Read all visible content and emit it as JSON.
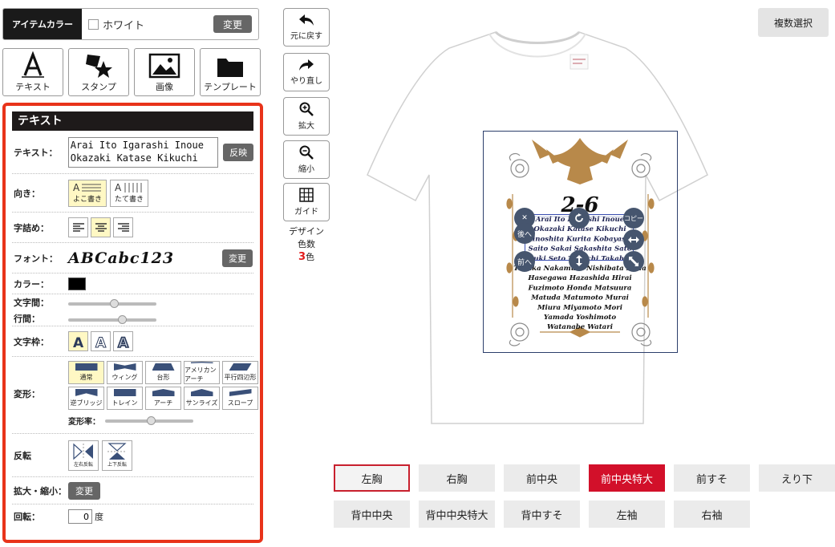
{
  "item_color": {
    "label": "アイテムカラー",
    "value": "ホワイト",
    "change": "変更"
  },
  "tools": [
    "テキスト",
    "スタンプ",
    "画像",
    "テンプレート"
  ],
  "panel": {
    "title": "テキスト",
    "text_label": "テキスト：",
    "text_value": "Arai Ito Igarashi Inoue\nOkazaki Katase Kikuchi",
    "apply": "反映",
    "orientation_label": "向き：",
    "orientation_options": [
      "よこ書き",
      "たて書き"
    ],
    "align_label": "字詰め：",
    "font_label": "フォント：",
    "font_preview": "ABCabc123",
    "font_change": "変更",
    "color_label": "カラー：",
    "text_color": "#000000",
    "spacing_label": "文字間：",
    "letter_spacing": 0.5,
    "line_label": "行間：",
    "line_spacing": 0.6,
    "outline_label": "文字枠：",
    "warp_label": "変形：",
    "warp_options": [
      "通常",
      "ウィング",
      "台形",
      "アメリカンアーチ",
      "平行四辺形",
      "逆ブリッジ",
      "トレイン",
      "アーチ",
      "サンライズ",
      "スロープ"
    ],
    "warp_rate_label": "変形率：",
    "warp_rate": 0.5,
    "flip_label": "反転",
    "flip_options": [
      "左右反転",
      "上下反転"
    ],
    "scale_label": "拡大・縮小：",
    "scale_change": "変更",
    "rotate_label": "回転：",
    "rotate_value": "0",
    "rotate_unit": "度"
  },
  "edit_tools": [
    "元に戻す",
    "やり直し",
    "拡大",
    "縮小",
    "ガイド"
  ],
  "design_colors": {
    "line1": "デザイン",
    "line2": "色数",
    "count": "3",
    "unit": "色"
  },
  "multi_select": "複数選択",
  "design": {
    "title": "2-6",
    "names": [
      "Arai Ito Igarashi Inoue",
      "Okazaki Katase Kikuchi",
      "Kinoshita Kurita Kobayashi",
      "Saito Sakai Sakashita Sato",
      "Suzuki Seto Taguchi Takahashi",
      "Tanaka Nakamura Nishibata Noda",
      "Hasegawa Hazashida Hirai",
      "Fuzimoto Honda Matsuura",
      "Matuda Matumoto Murai",
      "Miura Miyamoto Mori",
      "Yamada Yoshimoto",
      "Watanabe Watari"
    ],
    "handles": {
      "close": "✕",
      "back": "後へ",
      "front": "前へ",
      "copy": "コピー"
    },
    "tshirt_color": "#ffffff",
    "accent_color": "#b8894a"
  },
  "positions": [
    [
      "左胸",
      "右胸",
      "前中央",
      "前中央特大",
      "前すそ",
      "えり下"
    ],
    [
      "背中中央",
      "背中中央特大",
      "背中すそ",
      "左袖",
      "右袖"
    ]
  ]
}
